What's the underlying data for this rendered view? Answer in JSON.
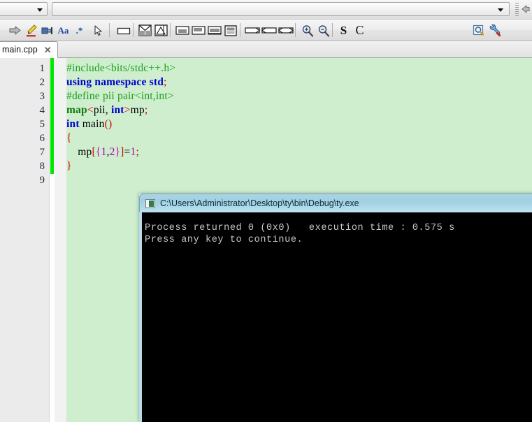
{
  "toolbar_top": {
    "scope_combo": {
      "value": "",
      "placeholder": ""
    },
    "symbol_combo": {
      "value": "",
      "placeholder": ""
    },
    "back_button": "back-arrow"
  },
  "toolbar_main": {
    "buttons": [
      {
        "name": "run-arrow-icon",
        "glyph": "⇨"
      },
      {
        "name": "highlight-pen-icon",
        "glyph": "╱"
      },
      {
        "name": "plugin-icon",
        "glyph": "▣"
      },
      {
        "name": "font-aa-icon",
        "glyph": "Aa"
      },
      {
        "name": "wildcard-icon",
        "glyph": ".*"
      },
      {
        "name": "pointer-select-icon",
        "glyph": "↖"
      },
      {
        "name": "rectangle-frame-icon",
        "glyph": "▭"
      },
      {
        "name": "split-quad-icon",
        "glyph": "⨉"
      },
      {
        "name": "image-frame-icon",
        "glyph": "▨"
      },
      {
        "name": "layout-top-icon",
        "glyph": "▤"
      },
      {
        "name": "layout-left-icon",
        "glyph": "▥"
      },
      {
        "name": "layout-full-icon",
        "glyph": "▦"
      },
      {
        "name": "layout-panel-icon",
        "glyph": "▧"
      },
      {
        "name": "tag-right-icon",
        "glyph": "▭"
      },
      {
        "name": "tag-left-icon",
        "glyph": "▭"
      },
      {
        "name": "tag-both-icon",
        "glyph": "▭"
      },
      {
        "name": "zoom-in-icon",
        "glyph": "⊕"
      },
      {
        "name": "zoom-out-icon",
        "glyph": "⊖"
      },
      {
        "name": "bold-s-icon",
        "glyph": "S"
      },
      {
        "name": "serif-c-icon",
        "glyph": "C"
      }
    ],
    "find_combo": {
      "value": "",
      "placeholder": ""
    },
    "find_button": "find-icon",
    "settings_button": "wrench-icon"
  },
  "tabs": [
    {
      "label": "main.cpp",
      "close": "✕",
      "active": true
    }
  ],
  "editor": {
    "line_numbers": [
      "1",
      "2",
      "3",
      "4",
      "5",
      "6",
      "7",
      "8",
      "9"
    ],
    "background_color": "#ceeece",
    "change_marker_color": "#00e800",
    "lines": [
      {
        "n": 1,
        "tokens": [
          {
            "t": "#include<bits/stdc++.h>",
            "c": "k-pre"
          }
        ]
      },
      {
        "n": 2,
        "tokens": [
          {
            "t": "using namespace std",
            "c": "k-kw"
          },
          {
            "t": ";",
            "c": "k-op"
          }
        ]
      },
      {
        "n": 3,
        "tokens": [
          {
            "t": "#define pii pair<int,int>",
            "c": "k-pre"
          }
        ]
      },
      {
        "n": 4,
        "tokens": [
          {
            "t": "map",
            "c": "k-type"
          },
          {
            "t": "<",
            "c": "k-op"
          },
          {
            "t": "pii,",
            "c": "k-txt"
          },
          {
            "t": " int",
            "c": "k-kw"
          },
          {
            "t": ">",
            "c": "k-op"
          },
          {
            "t": "mp",
            "c": "k-txt"
          },
          {
            "t": ";",
            "c": "k-op"
          }
        ]
      },
      {
        "n": 5,
        "tokens": [
          {
            "t": "int",
            "c": "k-kw"
          },
          {
            "t": " main",
            "c": "k-txt"
          },
          {
            "t": "()",
            "c": "k-op"
          }
        ]
      },
      {
        "n": 6,
        "tokens": [
          {
            "t": "{",
            "c": "k-brace"
          }
        ]
      },
      {
        "n": 7,
        "tokens": [
          {
            "t": "    mp",
            "c": "k-txt"
          },
          {
            "t": "[",
            "c": "k-op"
          },
          {
            "t": "{",
            "c": "k-mag"
          },
          {
            "t": "1",
            "c": "k-num"
          },
          {
            "t": ",",
            "c": "k-txt"
          },
          {
            "t": "2",
            "c": "k-num"
          },
          {
            "t": "}",
            "c": "k-mag"
          },
          {
            "t": "]",
            "c": "k-op"
          },
          {
            "t": "=",
            "c": "k-txt"
          },
          {
            "t": "1",
            "c": "k-num"
          },
          {
            "t": ";",
            "c": "k-op"
          }
        ]
      },
      {
        "n": 8,
        "tokens": [
          {
            "t": "}",
            "c": "k-brace"
          }
        ]
      },
      {
        "n": 9,
        "tokens": []
      }
    ]
  },
  "console": {
    "title": "C:\\Users\\Administrator\\Desktop\\ty\\bin\\Debug\\ty.exe",
    "titlebar_color": "#a8d4e5",
    "background_color": "#000000",
    "text_color": "#c8c8c8",
    "lines": [
      "Process returned 0 (0x0)   execution time : 0.575 s",
      "Press any key to continue."
    ]
  }
}
